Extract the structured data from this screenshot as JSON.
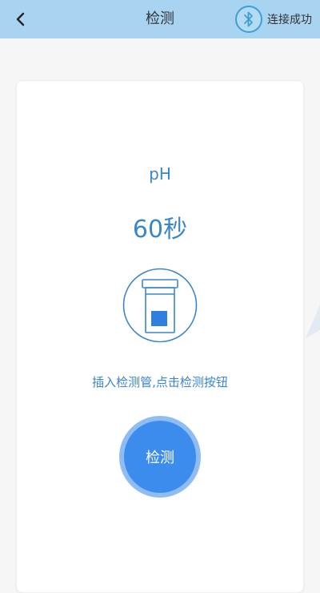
{
  "header": {
    "back_icon": "chevron-left-icon",
    "title": "检测",
    "bluetooth_icon": "bluetooth-icon",
    "bluetooth_status": "连接成功"
  },
  "main": {
    "parameter": "pH",
    "countdown": "60秒",
    "illustration_icon": "test-tube-icon",
    "instruction": "插入检测管,点击检测按钮",
    "detect_button_label": "检测"
  },
  "colors": {
    "header_bg": "#a8d4f2",
    "accent_text": "#3a86c8",
    "button_fill": "#3c8ced",
    "button_ring": "#8fbdf3",
    "illustration_fill": "#2f7fe0"
  }
}
